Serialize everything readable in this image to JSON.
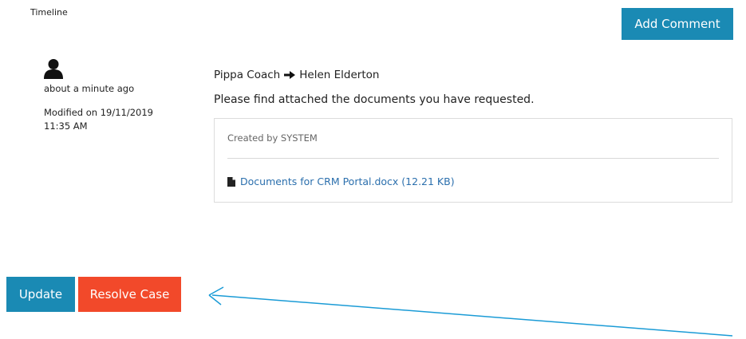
{
  "timeline": {
    "label": "Timeline"
  },
  "toolbar": {
    "add_comment_label": "Add Comment"
  },
  "entry": {
    "time_ago": "about a minute ago",
    "modified": "Modified on 19/11/2019 11:35 AM",
    "from": "Pippa Coach",
    "to": "Helen Elderton",
    "message": "Please find attached the documents you have requested.",
    "created_by": "Created by SYSTEM",
    "attachment": {
      "name": "Documents for CRM Portal.docx (12.21 KB)",
      "icon": "file-icon"
    },
    "avatar_icon": "user-icon",
    "arrow_icon": "arrow-right-icon"
  },
  "actions": {
    "update_label": "Update",
    "resolve_label": "Resolve Case"
  },
  "colors": {
    "primary": "#1a8ab4",
    "danger": "#f2492a",
    "link": "#2b6fad",
    "annotation": "#1a9bd6"
  }
}
